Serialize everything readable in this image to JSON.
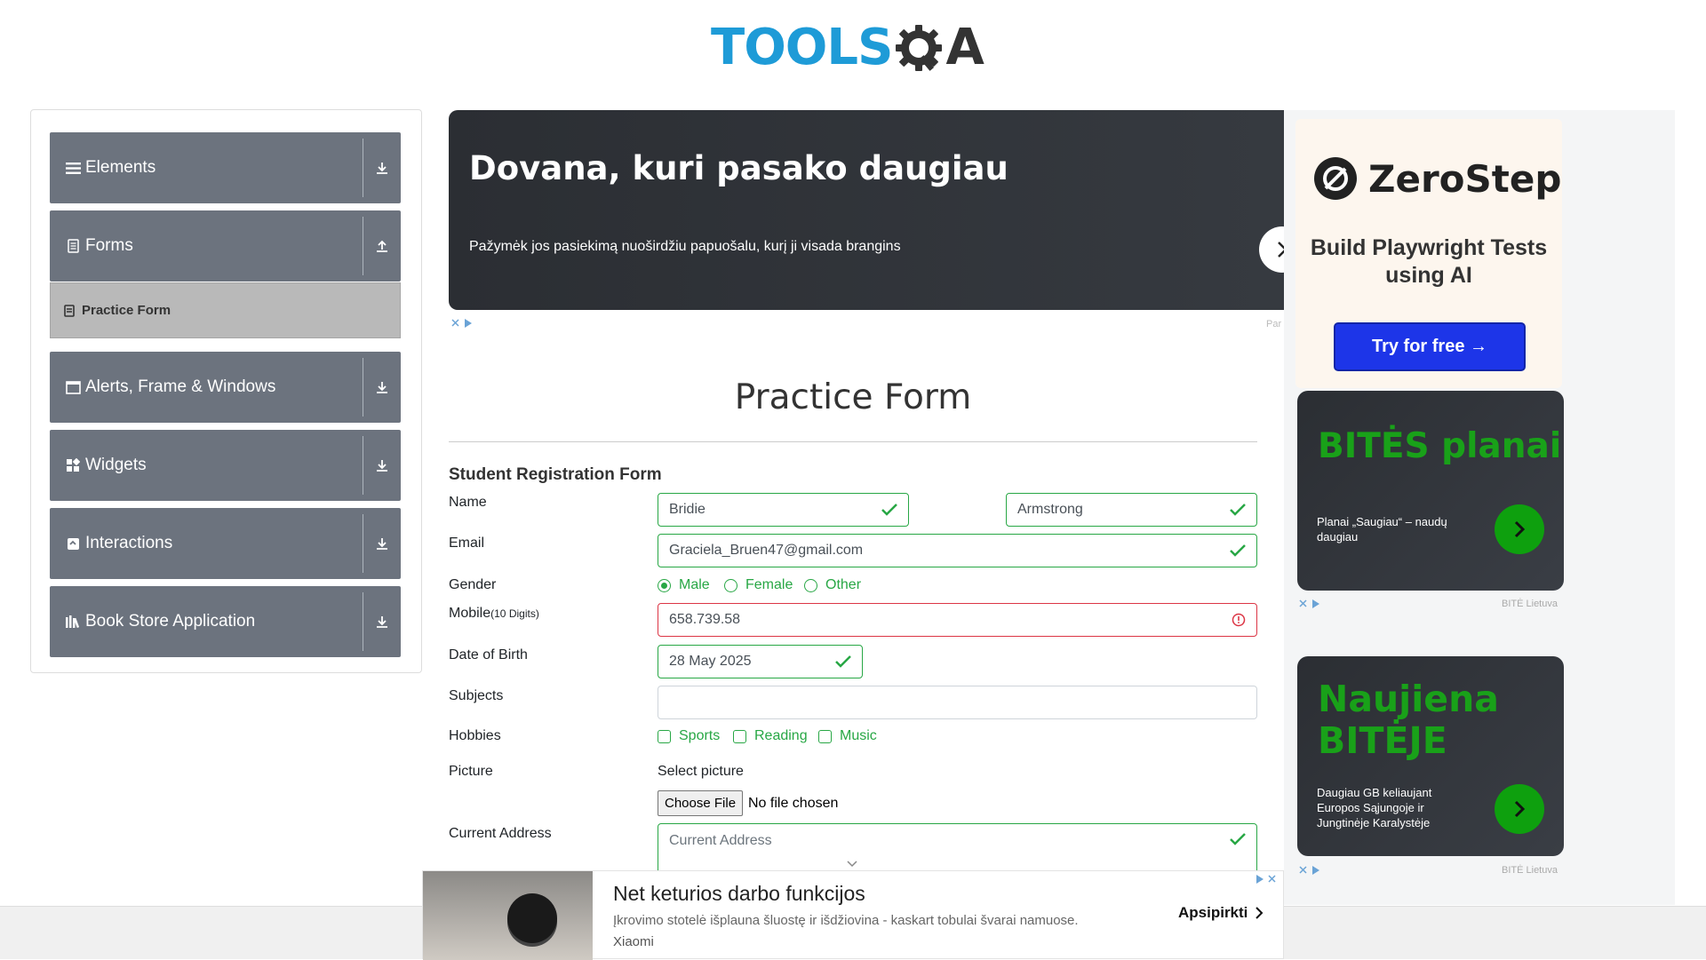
{
  "logo": {
    "part1": "TOOLS",
    "part2": "A"
  },
  "sidebar": {
    "groups": [
      {
        "label": "Elements",
        "icon": "menu-icon",
        "arrow": "download-icon"
      },
      {
        "label": "Forms",
        "icon": "document-icon",
        "arrow": "upload-icon"
      },
      {
        "label": "Alerts, Frame & Windows",
        "icon": "window-icon",
        "arrow": "download-icon"
      },
      {
        "label": "Widgets",
        "icon": "widgets-icon",
        "arrow": "download-icon"
      },
      {
        "label": "Interactions",
        "icon": "interactions-icon",
        "arrow": "download-icon"
      },
      {
        "label": "Book Store Application",
        "icon": "books-icon",
        "arrow": "download-icon"
      }
    ],
    "active_item": "Practice Form"
  },
  "ad_top": {
    "headline": "Dovana, kuri pasako daugiau",
    "text": "Pažymėk jos pasiekimą nuoširdžiu papuošalu, kurį ji visada brangins",
    "advertiser": "Par"
  },
  "form": {
    "page_title": "Practice Form",
    "subtitle": "Student Registration Form",
    "labels": {
      "name": "Name",
      "email": "Email",
      "gender": "Gender",
      "mobile": "Mobile",
      "mobile_hint": "(10 Digits)",
      "dob": "Date of Birth",
      "subjects": "Subjects",
      "hobbies": "Hobbies",
      "picture": "Picture",
      "address": "Current Address"
    },
    "first_name": "Bridie",
    "last_name": "Armstrong",
    "email": "Graciela_Bruen47@gmail.com",
    "genders": [
      "Male",
      "Female",
      "Other"
    ],
    "gender_selected": "Male",
    "mobile": "658.739.58",
    "dob": "28 May 2025",
    "subjects": "",
    "hobbies": [
      "Sports",
      "Reading",
      "Music"
    ],
    "select_picture": "Select picture",
    "choose_file": "Choose File",
    "no_file": "No file chosen",
    "address_placeholder": "Current Address"
  },
  "right_ads": {
    "zerostep": {
      "brand": "ZeroStep",
      "tagline": "Build Playwright Tests using AI",
      "button": "Try for free →"
    },
    "bite1": {
      "title": "BITĖS planai",
      "text": "Planai „Saugiau“ – naudų daugiau",
      "brand": "BITĖ Lietuva"
    },
    "bite2": {
      "title_line1": "Naujiena",
      "title_line2": "BITĖJE",
      "text": "Daugiau GB keliaujant Europos Sąjungoje ir Jungtinėje Karalystėje",
      "brand": "BITĖ Lietuva"
    }
  },
  "bottom_ad": {
    "headline": "Net keturios darbo funkcijos",
    "text": "Įkrovimo stotelė išplauna šluostę ir išdžiovina - kaskart tobulai švarai namuose.",
    "brand": "Xiaomi",
    "button": "Apsipirkti"
  },
  "colors": {
    "accent": "#28a745",
    "error": "#dc3545",
    "sidebar": "#6c737e",
    "logo_blue": "#1e9bd7",
    "bite_green": "#19a119"
  }
}
